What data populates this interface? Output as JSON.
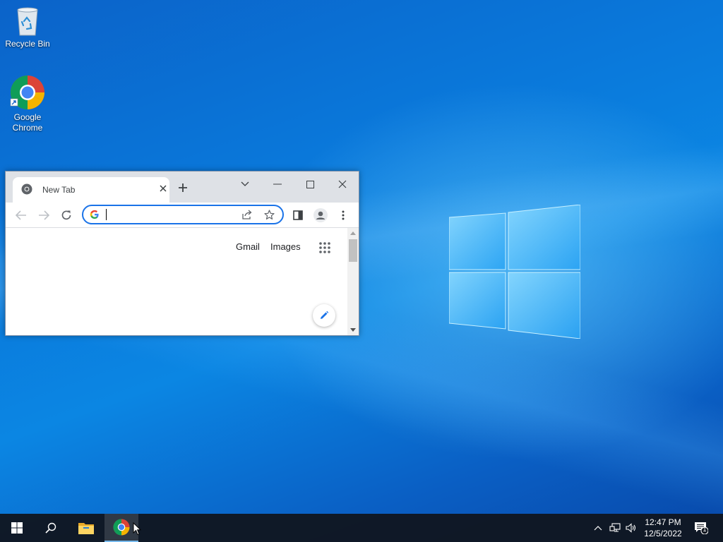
{
  "desktop": {
    "icons": [
      {
        "label": "Recycle Bin",
        "icon": "recycle-bin-icon"
      },
      {
        "label": "Google Chrome",
        "icon": "chrome-icon"
      }
    ]
  },
  "browser": {
    "tab": {
      "title": "New Tab"
    },
    "omnibox": {
      "value": "",
      "placeholder": ""
    },
    "content": {
      "links": [
        "Gmail",
        "Images"
      ]
    }
  },
  "taskbar": {
    "clock": {
      "time": "12:47 PM",
      "date": "12/5/2022"
    },
    "notification_count": "1"
  },
  "colors": {
    "accent": "#1a73e8",
    "taskbar": "#101620",
    "desktop": "#0a79db"
  }
}
